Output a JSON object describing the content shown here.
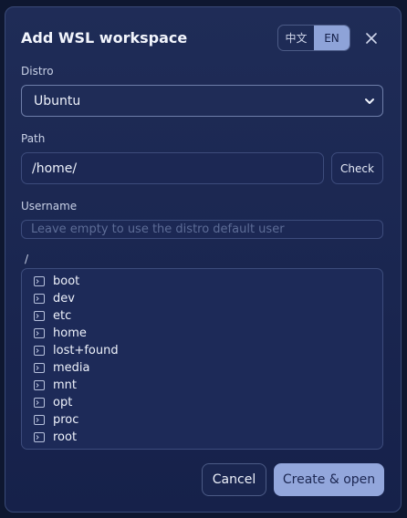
{
  "dialog": {
    "title": "Add WSL workspace",
    "lang_options": [
      "中文",
      "EN"
    ],
    "lang_selected": "EN",
    "close_icon": "close-icon"
  },
  "distro": {
    "label": "Distro",
    "value": "Ubuntu"
  },
  "path": {
    "label": "Path",
    "value": "/home/",
    "check_label": "Check"
  },
  "username": {
    "label": "Username",
    "placeholder": "Leave empty to use the distro default user"
  },
  "browser": {
    "current_dir": "/",
    "entries": [
      "boot",
      "dev",
      "etc",
      "home",
      "lost+found",
      "media",
      "mnt",
      "opt",
      "proc",
      "root"
    ]
  },
  "actions": {
    "cancel_label": "Cancel",
    "create_label": "Create & open"
  },
  "colors": {
    "accent": "#93a7dc",
    "background": "#1c2852",
    "border": "#3d4c7c"
  }
}
